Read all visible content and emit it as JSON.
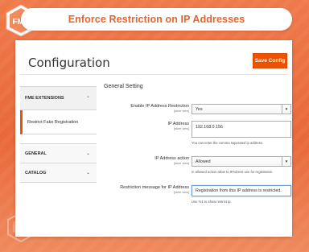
{
  "header": {
    "title": "Enforce Restriction on IP Addresses"
  },
  "logo": {
    "text": "FME"
  },
  "page": {
    "title": "Configuration",
    "save_label": "Save Config"
  },
  "sidebar": {
    "extensions_label": "FME EXTENSIONS",
    "active_item": "Restrict Fake Registration",
    "general_label": "GENERAL",
    "catalog_label": "CATALOG"
  },
  "section": {
    "title": "General Setting"
  },
  "fields": {
    "enable": {
      "label": "Enable IP Address Restriction",
      "scope": "[store view]",
      "value": "Yes"
    },
    "ip": {
      "label": "IP Address",
      "scope": "[store view]",
      "value": "192.168.0.156",
      "note": "You can enter the comma seperated ip address."
    },
    "action": {
      "label": "IP Address action",
      "scope": "[store view]",
      "value": "Allowed",
      "note": "In allowed action allow to IPAdress use for registration."
    },
    "message": {
      "label": "Restriction message for IP Address",
      "scope": "[store view]",
      "value": "Registration from this IP address is restricted.",
      "note": "Use %1 to show restrict ip."
    }
  },
  "colors": {
    "accent": "#eb5202",
    "brand": "#e8632f"
  },
  "icons": {
    "chevron_up": "chevron-up-icon",
    "chevron_down": "chevron-down-icon",
    "select_arrow": "triangle-down-icon"
  }
}
